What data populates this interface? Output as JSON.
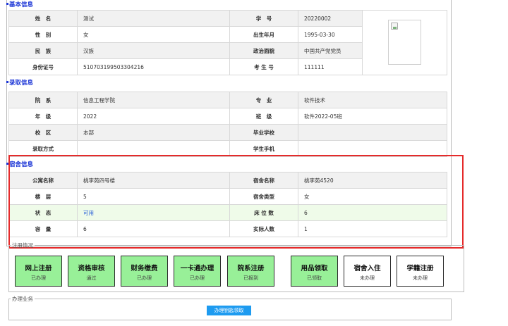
{
  "basic": {
    "title": "基本信息",
    "rows": [
      {
        "l1": "姓　名",
        "v1": "测试",
        "l2": "学　号",
        "v2": "20220002"
      },
      {
        "l1": "性　别",
        "v1": "女",
        "l2": "出生年月",
        "v2": "1995-03-30"
      },
      {
        "l1": "民　族",
        "v1": "汉族",
        "l2": "政治面貌",
        "v2": "中国共产党党员"
      },
      {
        "l1": "身份证号",
        "v1": "510703199503304216",
        "l2": "考 生 号",
        "v2": "111111"
      }
    ]
  },
  "admission": {
    "title": "录取信息",
    "rows": [
      {
        "l1": "院　系",
        "v1": "信息工程学院",
        "l2": "专　业",
        "v2": "软件技术"
      },
      {
        "l1": "年　级",
        "v1": "2022",
        "l2": "班　级",
        "v2": "软件2022-05班"
      },
      {
        "l1": "校　区",
        "v1": "本部",
        "l2": "毕业学校",
        "v2": ""
      },
      {
        "l1": "录取方式",
        "v1": "",
        "l2": "学生手机",
        "v2": ""
      }
    ]
  },
  "dorm": {
    "title": "宿舍信息",
    "rows": [
      {
        "l1": "公寓名称",
        "v1": "桃李苑四号楼",
        "l2": "宿舍名称",
        "v2": "桃李苑4520"
      },
      {
        "l1": "楼　层",
        "v1": "5",
        "l2": "宿舍类型",
        "v2": "女"
      },
      {
        "l1": "状　态",
        "v1": "可用",
        "l2": "床 位 数",
        "v2": "6"
      },
      {
        "l1": "容　量",
        "v1": "6",
        "l2": "实际人数",
        "v2": "1"
      }
    ]
  },
  "registration": {
    "legend": "注册情况",
    "steps": [
      {
        "title": "网上注册",
        "status": "已办理",
        "done": true
      },
      {
        "title": "资格审核",
        "status": "通过",
        "done": true
      },
      {
        "title": "财务缴费",
        "status": "已办理",
        "done": true
      },
      {
        "title": "一卡通办理",
        "status": "已办理",
        "done": true
      },
      {
        "title": "院系注册",
        "status": "已报到",
        "done": true
      },
      {
        "title": "用品领取",
        "status": "已领取",
        "done": true
      },
      {
        "title": "宿舍入住",
        "status": "未办理",
        "done": false
      },
      {
        "title": "学籍注册",
        "status": "未办理",
        "done": false
      }
    ]
  },
  "business": {
    "legend": "办理业务",
    "button_label": "办理钥匙领取"
  },
  "colors": {
    "section_title": "#1b35d6",
    "done_step": "#98f098",
    "highlight_border": "#e52b2b",
    "button": "#1e9bf0"
  }
}
